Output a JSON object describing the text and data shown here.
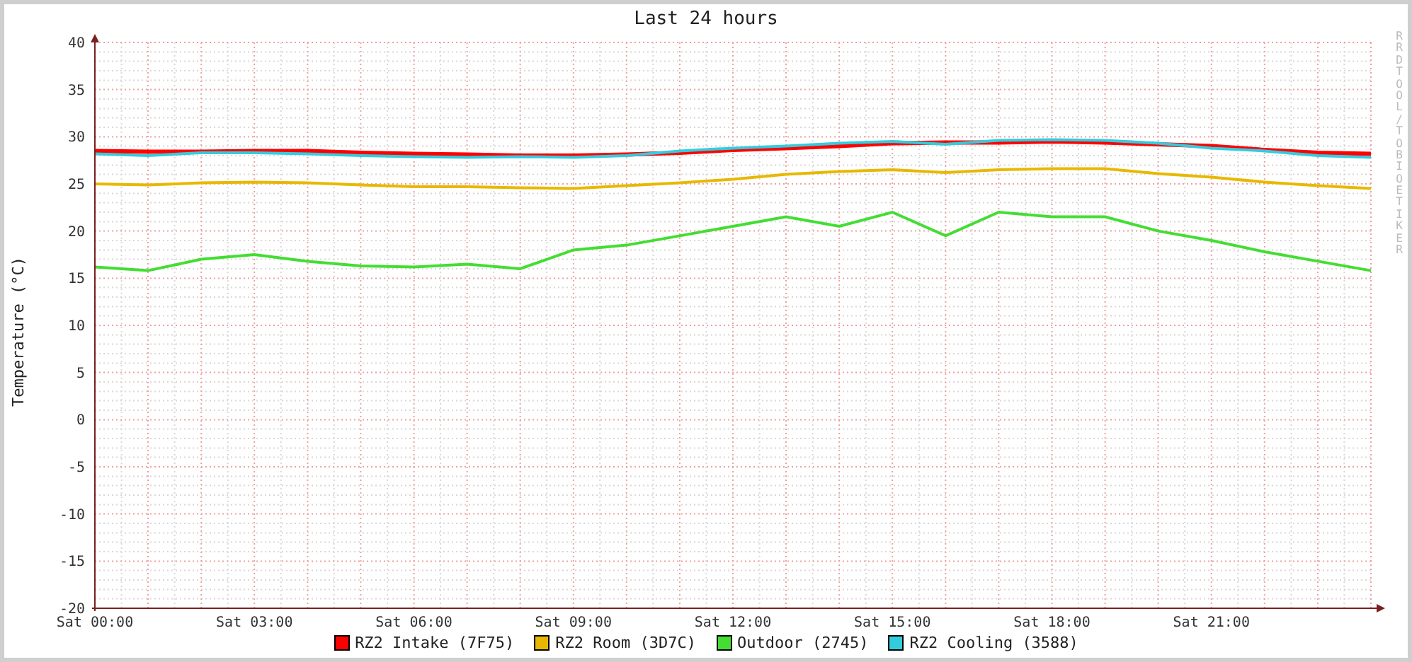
{
  "chart_data": {
    "type": "line",
    "title": "Last 24 hours",
    "ylabel": "Temperature (°C)",
    "categories": [
      "Sat 00:00",
      null,
      null,
      "Sat 03:00",
      null,
      null,
      "Sat 06:00",
      null,
      null,
      "Sat 09:00",
      null,
      null,
      "Sat 12:00",
      null,
      null,
      "Sat 15:00",
      null,
      null,
      "Sat 18:00",
      null,
      null,
      "Sat 21:00",
      null,
      null,
      null
    ],
    "ylim": [
      -20,
      40
    ],
    "grid": true,
    "yticks": [
      40,
      35,
      30,
      25,
      20,
      15,
      10,
      5,
      0,
      -5,
      -10,
      -15,
      -20
    ],
    "series": [
      {
        "name": "RZ2 Intake (7F75)",
        "color": "#ff0000",
        "values": [
          28.5,
          28.4,
          28.4,
          28.5,
          28.5,
          28.3,
          28.2,
          28.1,
          28.0,
          28.0,
          28.1,
          28.3,
          28.6,
          28.8,
          29.0,
          29.3,
          29.4,
          29.4,
          29.5,
          29.4,
          29.2,
          29.0,
          28.6,
          28.3,
          28.2
        ]
      },
      {
        "name": "RZ2 Room (3D7C)",
        "color": "#e8b800",
        "values": [
          25.0,
          24.9,
          25.1,
          25.2,
          25.1,
          24.9,
          24.7,
          24.7,
          24.6,
          24.5,
          24.8,
          25.1,
          25.5,
          26.0,
          26.3,
          26.5,
          26.2,
          26.5,
          26.6,
          26.6,
          26.1,
          25.7,
          25.2,
          24.8,
          24.5
        ]
      },
      {
        "name": "Outdoor (2745)",
        "color": "#44dd33",
        "values": [
          16.2,
          15.8,
          17.0,
          17.5,
          16.8,
          16.3,
          16.2,
          16.5,
          16.0,
          18.0,
          18.5,
          19.5,
          20.5,
          21.5,
          20.5,
          22.0,
          19.5,
          22.0,
          21.5,
          21.5,
          20.0,
          19.0,
          17.8,
          16.8,
          15.8
        ]
      },
      {
        "name": "RZ2 Cooling (3588)",
        "color": "#33ccdd",
        "values": [
          28.2,
          28.0,
          28.3,
          28.3,
          28.2,
          28.0,
          27.9,
          27.8,
          27.9,
          27.8,
          28.0,
          28.5,
          28.8,
          29.0,
          29.3,
          29.5,
          29.2,
          29.6,
          29.7,
          29.6,
          29.3,
          28.8,
          28.5,
          28.0,
          27.8
        ]
      }
    ]
  },
  "credit": "RRDTOOL / TOBI OETIKER"
}
